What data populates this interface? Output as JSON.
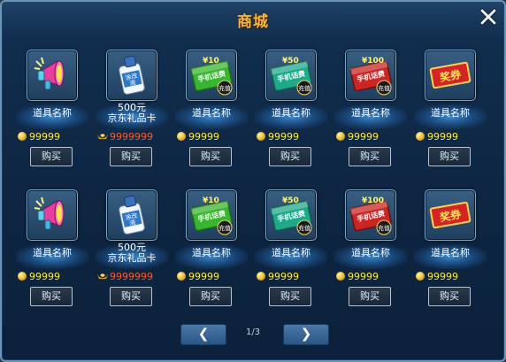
{
  "window": {
    "title": "商城"
  },
  "items_row1": [
    {
      "icon": "megaphone-icon",
      "name_lines": [
        "道具名称"
      ],
      "price": "99999",
      "currency": "coin-icon",
      "price_color": "#ffea3b",
      "buy_label": "购买"
    },
    {
      "icon": "glue-bottle-icon",
      "icon_text": "涂改液",
      "name_lines": [
        "500元",
        "京东礼品卡"
      ],
      "price": "9999999",
      "currency": "gold-ingot-icon",
      "price_color": "#ff5a2a",
      "buy_label": "购买"
    },
    {
      "icon": "phone-card-10-icon",
      "card_amount": "¥10",
      "card_text": "手机话费",
      "card_badge": "充值",
      "name_lines": [
        "道具名称"
      ],
      "price": "99999",
      "currency": "coin-icon",
      "price_color": "#ffea3b",
      "buy_label": "购买"
    },
    {
      "icon": "phone-card-50-icon",
      "card_amount": "¥50",
      "card_text": "手机话费",
      "card_badge": "充值",
      "name_lines": [
        "道具名称"
      ],
      "price": "99999",
      "currency": "coin-icon",
      "price_color": "#ffea3b",
      "buy_label": "购买"
    },
    {
      "icon": "phone-card-100-icon",
      "card_amount": "¥100",
      "card_text": "手机话费",
      "card_badge": "充值",
      "name_lines": [
        "道具名称"
      ],
      "price": "99999",
      "currency": "coin-icon",
      "price_color": "#ffea3b",
      "buy_label": "购买"
    },
    {
      "icon": "voucher-icon",
      "voucher_text": "奖券",
      "name_lines": [
        "道具名称"
      ],
      "price": "99999",
      "currency": "coin-icon",
      "price_color": "#ffea3b",
      "buy_label": "购买"
    }
  ],
  "items_row2": [
    {
      "icon": "megaphone-icon",
      "name_lines": [
        "道具名称"
      ],
      "price": "99999",
      "currency": "coin-icon",
      "price_color": "#ffea3b",
      "buy_label": "购买"
    },
    {
      "icon": "glue-bottle-icon",
      "icon_text": "涂改液",
      "name_lines": [
        "500元",
        "京东礼品卡"
      ],
      "price": "9999999",
      "currency": "gold-ingot-icon",
      "price_color": "#ff5a2a",
      "buy_label": "购买"
    },
    {
      "icon": "phone-card-10-icon",
      "card_amount": "¥10",
      "card_text": "手机话费",
      "card_badge": "充值",
      "name_lines": [
        "道具名称"
      ],
      "price": "99999",
      "currency": "coin-icon",
      "price_color": "#ffea3b",
      "buy_label": "购买"
    },
    {
      "icon": "phone-card-50-icon",
      "card_amount": "¥50",
      "card_text": "手机话费",
      "card_badge": "充值",
      "name_lines": [
        "道具名称"
      ],
      "price": "99999",
      "currency": "coin-icon",
      "price_color": "#ffea3b",
      "buy_label": "购买"
    },
    {
      "icon": "phone-card-100-icon",
      "card_amount": "¥100",
      "card_text": "手机话费",
      "card_badge": "充值",
      "name_lines": [
        "道具名称"
      ],
      "price": "99999",
      "currency": "coin-icon",
      "price_color": "#ffea3b",
      "buy_label": "购买"
    },
    {
      "icon": "voucher-icon",
      "voucher_text": "奖券",
      "name_lines": [
        "道具名称"
      ],
      "price": "99999",
      "currency": "coin-icon",
      "price_color": "#ffea3b",
      "buy_label": "购买"
    }
  ],
  "pagination": {
    "prev_icon": "chevron-left-icon",
    "next_icon": "chevron-right-icon",
    "page_text": "1/3"
  },
  "colors": {
    "title": "#f6b73b",
    "price": "#ffea3b",
    "price_special": "#ff5a2a",
    "panel": "#0e2744",
    "border": "#6f93b5"
  }
}
